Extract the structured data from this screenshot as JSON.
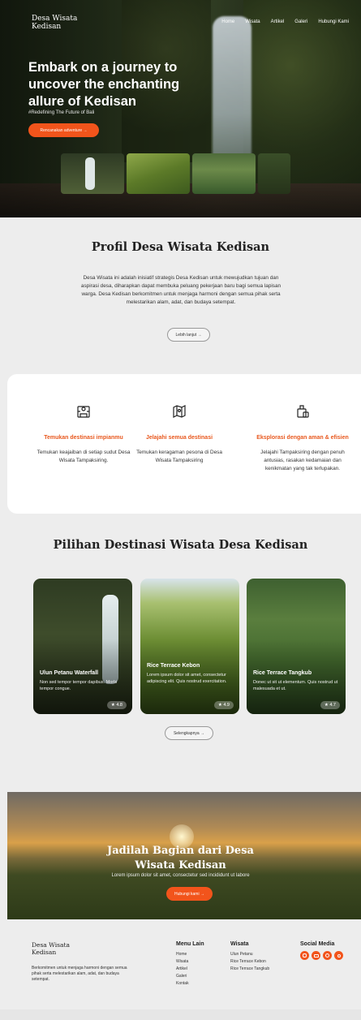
{
  "nav": {
    "logo": "Desa Wisata Kedisan",
    "links": [
      "Home",
      "Wisata",
      "Artikel",
      "Galeri",
      "Hubungi Kami"
    ]
  },
  "hero": {
    "title": "Embark on a journey to uncover the enchanting allure of Kedisan",
    "subtitle": "#Redefining The Future of Bali",
    "button": "Rencanakan adventure →"
  },
  "profile": {
    "title": "Profil Desa Wisata Kedisan",
    "description": "Desa Wisata ini adalah inisiatif strategis Desa Kedisan untuk mewujudkan tujuan dan aspirasi desa, diharapkan dapat membuka peluang pekerjaan baru bagi semua lapisan warga. Desa Kedisan berkomitmen untuk menjaga harmoni dengan semua pihak serta melestarikan alam, adat, dan budaya setempat.",
    "button": "Lebih lanjut →"
  },
  "features": [
    {
      "icon": "map-person-icon",
      "title": "Temukan destinasi impianmu",
      "desc": "Temukan keajaiban di setiap sudut Desa Wisata Tampaksiring."
    },
    {
      "icon": "folded-map-icon",
      "title": "Jelajahi semua destinasi",
      "desc": "Temukan keragaman pesona di Desa Wisata Tampaksiring"
    },
    {
      "icon": "luggage-icon",
      "title": "Eksplorasi dengan aman & efisien",
      "desc": "Jelajahi Tampaksiring dengan penuh antusias, rasakan kedamaian dan kenikmatan yang tak terlupakan."
    }
  ],
  "destinations": {
    "title": "Pilihan Destinasi Wisata Desa Kedisan",
    "cards": [
      {
        "name": "Ulun Petanu Waterfall",
        "desc": "Non sed tempor tempor dapibus. Morbi tempor congue.",
        "rating": "4.8"
      },
      {
        "name": "Rice Terrace Kebon",
        "desc": "Lorem ipsum dolor sit amet, consectetur adipiscing elit. Quis nostrud exercitation.",
        "rating": "4.9"
      },
      {
        "name": "Rice Terrace Tangkub",
        "desc": "Donec ut sit ut elementum. Quis nostrud ut malesuada et ut.",
        "rating": "4.7"
      }
    ],
    "button": "Selengkapnya →"
  },
  "cta": {
    "title": "Jadilah Bagian dari Desa Wisata Kedisan",
    "subtitle": "Lorem ipsum dolor sit amet, consectetur sed incididunt ut labore",
    "button": "Hubungi kami →"
  },
  "footer": {
    "logo": "Desa Wisata Kedisan",
    "about": "Berkomitmen untuk menjaga harmoni dengan semua pihak serta melestarikan alam, adat, dan budaya setempat.",
    "menu_heading": "Menu Lain",
    "menu": [
      "Home",
      "Wisata",
      "Artikel",
      "Galeri",
      "Kontak"
    ],
    "wisata_heading": "Wisata",
    "wisata": [
      "Ulun Petanu",
      "Rice Terrace Kebon",
      "Rice Terrace Tangkub"
    ],
    "social_heading": "Social Media",
    "socials": [
      "instagram-icon",
      "youtube-icon",
      "facebook-icon",
      "tiktok-icon"
    ]
  },
  "colors": {
    "accent": "#f2541b",
    "feature_title": "#e8581e"
  }
}
